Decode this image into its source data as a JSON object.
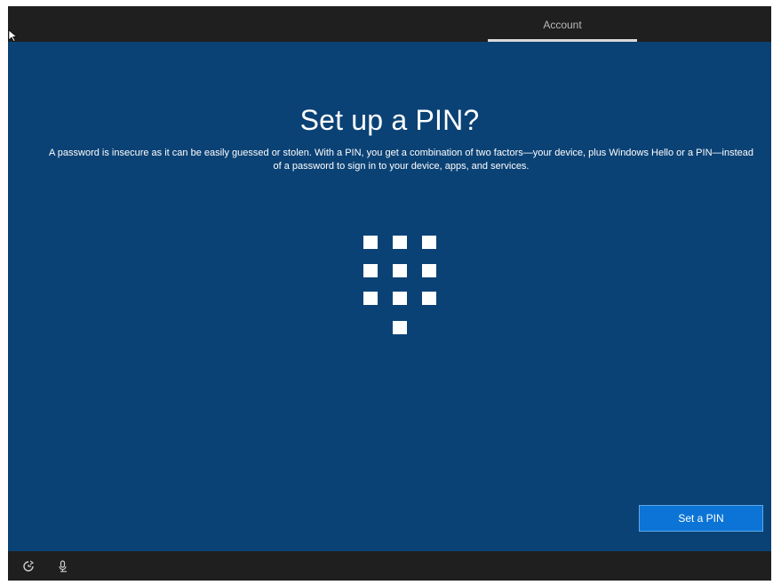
{
  "header": {
    "tabs": [
      {
        "label": "Account",
        "selected": true
      }
    ]
  },
  "main": {
    "title": "Set up a PIN?",
    "description": "A password is insecure as it can be easily guessed or stolen. With a PIN, you get a combination of two factors—your device, plus Windows Hello or a PIN—instead of a password to sign in to your device, apps, and services.",
    "illustration": "pin-keypad-icon",
    "primary_button_label": "Set a PIN"
  },
  "footer": {
    "icons": [
      "ease-of-access-icon",
      "microphone-icon"
    ]
  },
  "colors": {
    "background": "#0b4275",
    "bars": "#1f1f1f",
    "button": "#0b74d6",
    "text": "#ffffff"
  }
}
